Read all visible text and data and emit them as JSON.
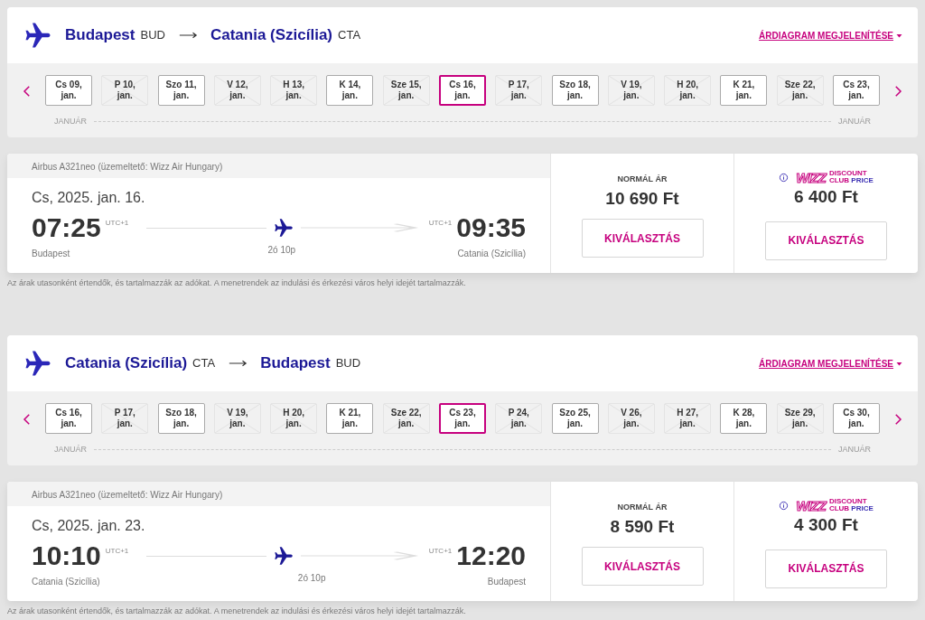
{
  "legs": [
    {
      "origin": {
        "city": "Budapest",
        "code": "BUD"
      },
      "destination": {
        "city": "Catania (Szicília)",
        "code": "CTA"
      },
      "price_chart_link": "ÁRDIAGRAM MEGJELENÍTÉSE",
      "dates": [
        {
          "day": "Cs 09,",
          "month": "jan.",
          "available": true,
          "selected": false
        },
        {
          "day": "P 10,",
          "month": "jan.",
          "available": false,
          "selected": false
        },
        {
          "day": "Szo 11,",
          "month": "jan.",
          "available": true,
          "selected": false
        },
        {
          "day": "V 12,",
          "month": "jan.",
          "available": false,
          "selected": false
        },
        {
          "day": "H 13,",
          "month": "jan.",
          "available": false,
          "selected": false
        },
        {
          "day": "K 14,",
          "month": "jan.",
          "available": true,
          "selected": false
        },
        {
          "day": "Sze 15,",
          "month": "jan.",
          "available": false,
          "selected": false
        },
        {
          "day": "Cs 16,",
          "month": "jan.",
          "available": true,
          "selected": true
        },
        {
          "day": "P 17,",
          "month": "jan.",
          "available": false,
          "selected": false
        },
        {
          "day": "Szo 18,",
          "month": "jan.",
          "available": true,
          "selected": false
        },
        {
          "day": "V 19,",
          "month": "jan.",
          "available": false,
          "selected": false
        },
        {
          "day": "H 20,",
          "month": "jan.",
          "available": false,
          "selected": false
        },
        {
          "day": "K 21,",
          "month": "jan.",
          "available": true,
          "selected": false
        },
        {
          "day": "Sze 22,",
          "month": "jan.",
          "available": false,
          "selected": false
        },
        {
          "day": "Cs 23,",
          "month": "jan.",
          "available": true,
          "selected": false
        }
      ],
      "month_labels": [
        "JANUÁR",
        "JANUÁR"
      ],
      "flight": {
        "aircraft": "Airbus A321neo (üzemeltető: Wizz Air Hungary)",
        "date": "Cs, 2025. jan. 16.",
        "departure_time": "07:25",
        "departure_tz": "UTC+1",
        "departure_city": "Budapest",
        "duration": "2ó 10p",
        "arrival_tz": "UTC+1",
        "arrival_time": "09:35",
        "arrival_city": "Catania (Szicília)"
      },
      "fares": [
        {
          "kind": "normal",
          "label": "NORMÁL ÁR",
          "price": "10 690 Ft",
          "button": "KIVÁLASZTÁS"
        },
        {
          "kind": "club",
          "brand": "WIZZ",
          "line1": "DISCOUNT",
          "line2a": "CLUB",
          "line2b": "PRICE",
          "price": "6 400 Ft",
          "button": "KIVÁLASZTÁS"
        }
      ],
      "note": "Az árak utasonként értendők, és tartalmazzák az adókat. A menetrendek az indulási és érkezési város helyi idejét tartalmazzák."
    },
    {
      "origin": {
        "city": "Catania (Szicília)",
        "code": "CTA"
      },
      "destination": {
        "city": "Budapest",
        "code": "BUD"
      },
      "price_chart_link": "ÁRDIAGRAM MEGJELENÍTÉSE",
      "dates": [
        {
          "day": "Cs 16,",
          "month": "jan.",
          "available": true,
          "selected": false
        },
        {
          "day": "P 17,",
          "month": "jan.",
          "available": false,
          "selected": false
        },
        {
          "day": "Szo 18,",
          "month": "jan.",
          "available": true,
          "selected": false
        },
        {
          "day": "V 19,",
          "month": "jan.",
          "available": false,
          "selected": false
        },
        {
          "day": "H 20,",
          "month": "jan.",
          "available": false,
          "selected": false
        },
        {
          "day": "K 21,",
          "month": "jan.",
          "available": true,
          "selected": false
        },
        {
          "day": "Sze 22,",
          "month": "jan.",
          "available": false,
          "selected": false
        },
        {
          "day": "Cs 23,",
          "month": "jan.",
          "available": true,
          "selected": true
        },
        {
          "day": "P 24,",
          "month": "jan.",
          "available": false,
          "selected": false
        },
        {
          "day": "Szo 25,",
          "month": "jan.",
          "available": true,
          "selected": false
        },
        {
          "day": "V 26,",
          "month": "jan.",
          "available": false,
          "selected": false
        },
        {
          "day": "H 27,",
          "month": "jan.",
          "available": false,
          "selected": false
        },
        {
          "day": "K 28,",
          "month": "jan.",
          "available": true,
          "selected": false
        },
        {
          "day": "Sze 29,",
          "month": "jan.",
          "available": false,
          "selected": false
        },
        {
          "day": "Cs 30,",
          "month": "jan.",
          "available": true,
          "selected": false
        }
      ],
      "month_labels": [
        "JANUÁR",
        "JANUÁR"
      ],
      "flight": {
        "aircraft": "Airbus A321neo (üzemeltető: Wizz Air Hungary)",
        "date": "Cs, 2025. jan. 23.",
        "departure_time": "10:10",
        "departure_tz": "UTC+1",
        "departure_city": "Catania (Szicília)",
        "duration": "2ó 10p",
        "arrival_tz": "UTC+1",
        "arrival_time": "12:20",
        "arrival_city": "Budapest"
      },
      "fares": [
        {
          "kind": "normal",
          "label": "NORMÁL ÁR",
          "price": "8 590 Ft",
          "button": "KIVÁLASZTÁS"
        },
        {
          "kind": "club",
          "brand": "WIZZ",
          "line1": "DISCOUNT",
          "line2a": "CLUB",
          "line2b": "PRICE",
          "price": "4 300 Ft",
          "button": "KIVÁLASZTÁS"
        }
      ],
      "note": "Az árak utasonként értendők, és tartalmazzák az adókat. A menetrendek az indulási és érkezési város helyi idejét tartalmazzák."
    }
  ]
}
